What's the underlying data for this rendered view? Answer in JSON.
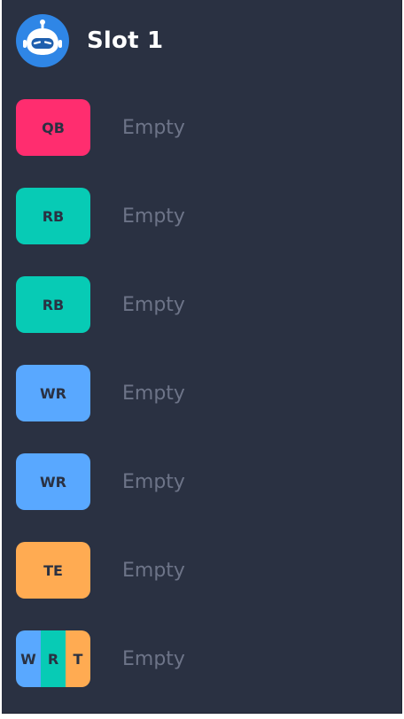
{
  "header": {
    "title": "Slot 1",
    "avatar_icon": "robot-icon"
  },
  "roster": [
    {
      "position": "QB",
      "color": "#ff2d6f",
      "status": "Empty"
    },
    {
      "position": "RB",
      "color": "#07cbb5",
      "status": "Empty"
    },
    {
      "position": "RB",
      "color": "#07cbb5",
      "status": "Empty"
    },
    {
      "position": "WR",
      "color": "#59a8ff",
      "status": "Empty"
    },
    {
      "position": "WR",
      "color": "#59a8ff",
      "status": "Empty"
    },
    {
      "position": "TE",
      "color": "#ffab52",
      "status": "Empty"
    },
    {
      "position": "WRT",
      "segments": [
        {
          "letter": "W",
          "color": "#59a8ff"
        },
        {
          "letter": "R",
          "color": "#07cbb5"
        },
        {
          "letter": "T",
          "color": "#ffab52"
        }
      ],
      "status": "Empty"
    }
  ],
  "colors": {
    "panel_bg": "#2a3142",
    "title_text": "#ffffff",
    "empty_text": "#6d7488",
    "avatar_bg": "#2f86e6"
  }
}
